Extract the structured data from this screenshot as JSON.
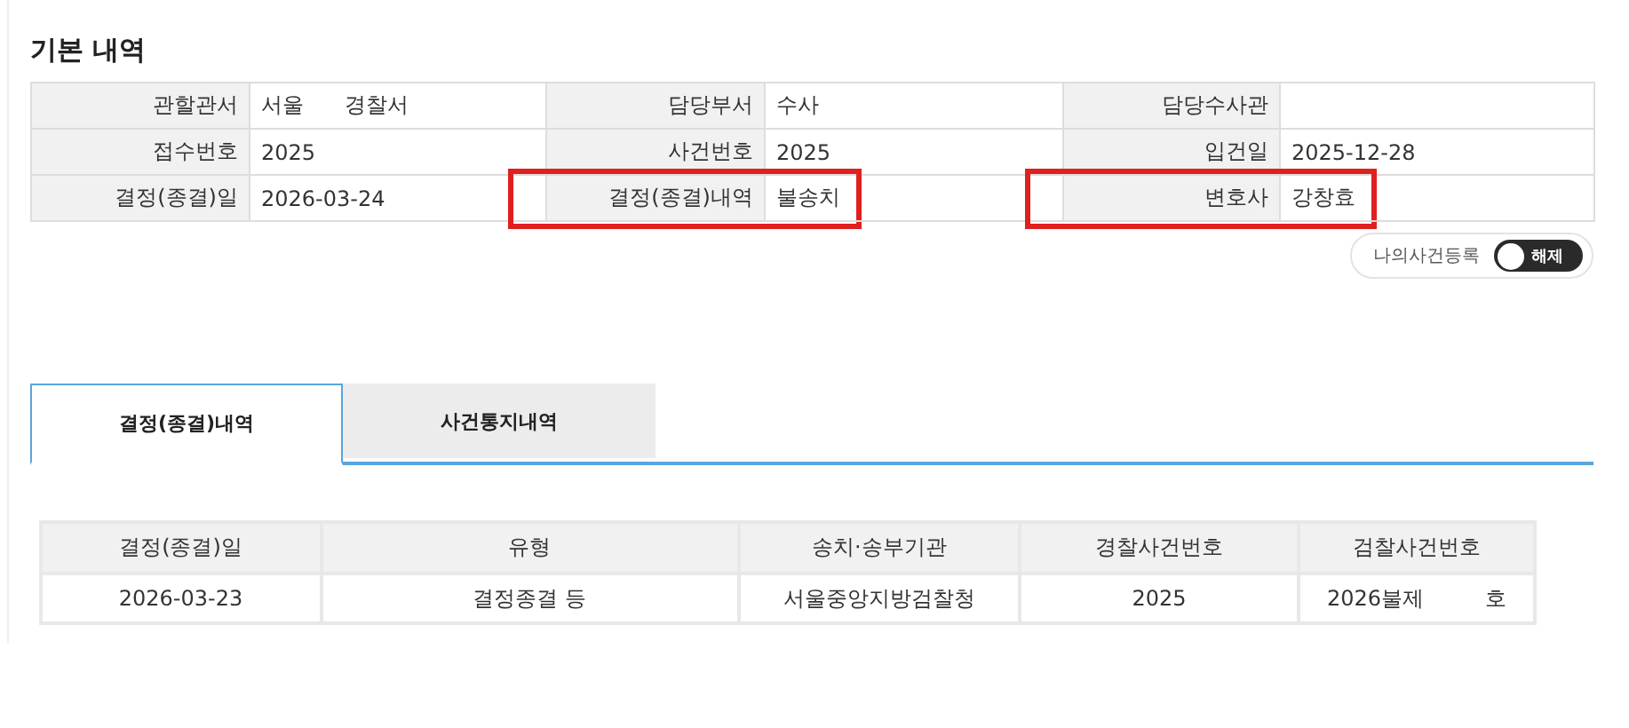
{
  "section_title": "기본 내역",
  "fields": [
    {
      "label": "관할관서",
      "value": "서울      경찰서",
      "highlighted": false
    },
    {
      "label": "담당부서",
      "value": "수사",
      "highlighted": false
    },
    {
      "label": "담당수사관",
      "highlighted": false
    },
    {
      "label": "접수번호",
      "value": "2025",
      "highlighted": false
    },
    {
      "label": "사건번호",
      "value": "2025",
      "highlighted": false
    },
    {
      "label": "입건일",
      "value": "2025-12-28",
      "highlighted": false
    },
    {
      "label": "결정(종결)일",
      "value": "2026-03-24",
      "highlighted": false
    },
    {
      "label": "결정(종결)내역",
      "value": "불송치",
      "highlighted": true
    },
    {
      "label": "변호사",
      "value": "강창효",
      "highlighted": true
    }
  ],
  "my_case_toggle": {
    "label": "나의사건등록",
    "state_text": "해제",
    "on": false
  },
  "tabs": [
    {
      "label": "결정(종결)내역",
      "selected": true
    },
    {
      "label": "사건통지내역",
      "selected": false
    }
  ],
  "table": {
    "columns": [
      "결정(종결)일",
      "유형",
      "송치·송부기관",
      "경찰사건번호",
      "검찰사건번호"
    ],
    "rows": [
      [
        "2026-03-23",
        "결정종결 등",
        "서울중앙지방검찰청",
        "2025",
        "2026불제         호"
      ]
    ]
  }
}
